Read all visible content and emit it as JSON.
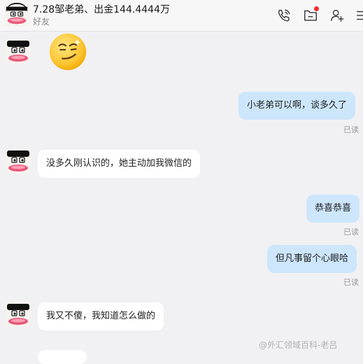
{
  "header": {
    "title": "7.28邹老弟、出金144.4444万",
    "subtitle": "好友",
    "icons": [
      "phone-call-icon",
      "folder-icon",
      "add-friend-icon",
      "menu-icon"
    ],
    "notification_dot_color": "#ee2d2d"
  },
  "messages": [
    {
      "side": "in",
      "type": "sticker",
      "sticker": "smirk-emoji"
    },
    {
      "side": "out",
      "text": "小老弟可以啊，谈多久了",
      "status": "已读"
    },
    {
      "side": "in",
      "text": "没多久刚认识的，她主动加我微信的"
    },
    {
      "side": "out",
      "text": "恭喜恭喜",
      "status": "已读"
    },
    {
      "side": "out",
      "text": "但凡事留个心眼哈",
      "status": "已读"
    },
    {
      "side": "in",
      "text": "我又不傻，我知道怎么做的"
    }
  ],
  "watermark": "@外汇领域百科-老吕",
  "colors": {
    "outgoing_bubble": "#cde6fb",
    "incoming_bubble": "#ffffff",
    "background": "#f1f1f3"
  }
}
